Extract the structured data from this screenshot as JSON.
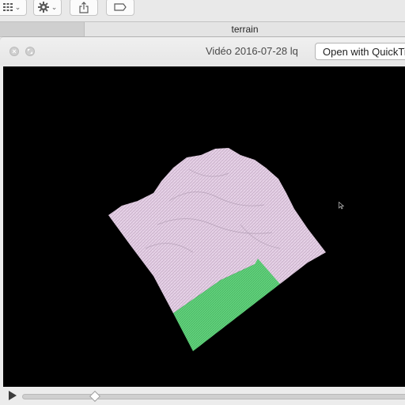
{
  "finder": {
    "active_tab": "terrain",
    "toolbar_icons": {
      "view": "grid-view-icon",
      "action": "gear-icon",
      "share": "share-icon",
      "tags": "tag-icon"
    }
  },
  "quicklook": {
    "title": "Vidéo 2016-07-28 lq",
    "open_button_label": "Open with QuickTime Player",
    "controls": {
      "play_icon": "play-icon",
      "playback_position": 0.13
    }
  },
  "colors": {
    "terrain_light": "#e5cfe6",
    "terrain_green": "#5fd07a",
    "viewport_bg": "#000000"
  }
}
